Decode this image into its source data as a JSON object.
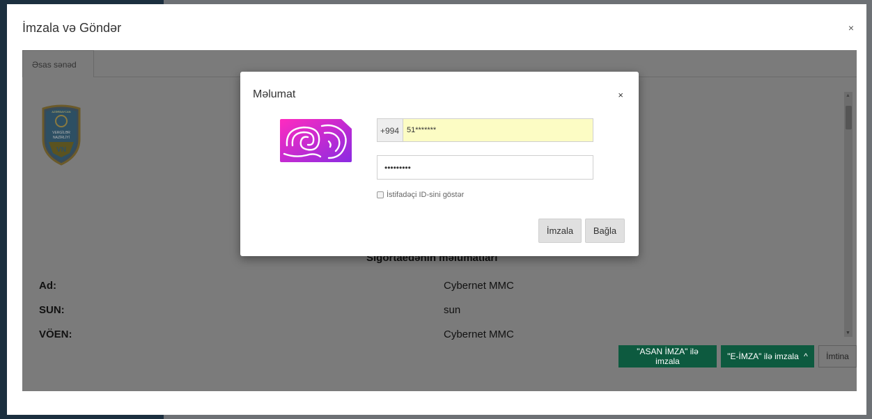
{
  "outer_dialog": {
    "title": "İmzala və Göndər",
    "close": "×",
    "tabs": [
      {
        "label": "Əsas sənəd"
      }
    ]
  },
  "document": {
    "emblem_text": [
      "AZƏRBAYCAN",
      "VERGİLƏR",
      "NAZİRLİYİ",
      "VN"
    ],
    "section_heading": "Sığortaedənin məlumatları",
    "rows": [
      {
        "label": "Ad:",
        "value": "Cybernet MMC"
      },
      {
        "label": "SUN:",
        "value": "sun"
      },
      {
        "label": "VÖEN:",
        "value": "Cybernet MMC"
      }
    ]
  },
  "footer": {
    "asan_label": "\"ASAN İMZA\" ilə imzala",
    "eimza_label": "\"E-İMZA\" ilə imzala",
    "eimza_caret": "^",
    "cancel_label": "İmtina"
  },
  "modal": {
    "title": "Məlumat",
    "close": "×",
    "phone_prefix": "+994",
    "phone_value": "51*******",
    "password_value": "•••••••••",
    "show_id_label": "İstifadəçi ID-sini göstər",
    "sign_label": "İmzala",
    "close_label": "Bağla"
  },
  "colors": {
    "accent_green": "#0d5a3f",
    "phone_input_bg": "#fcfcc4",
    "sim_gradient_start": "#ff2bbf",
    "sim_gradient_end": "#8a2be2"
  }
}
